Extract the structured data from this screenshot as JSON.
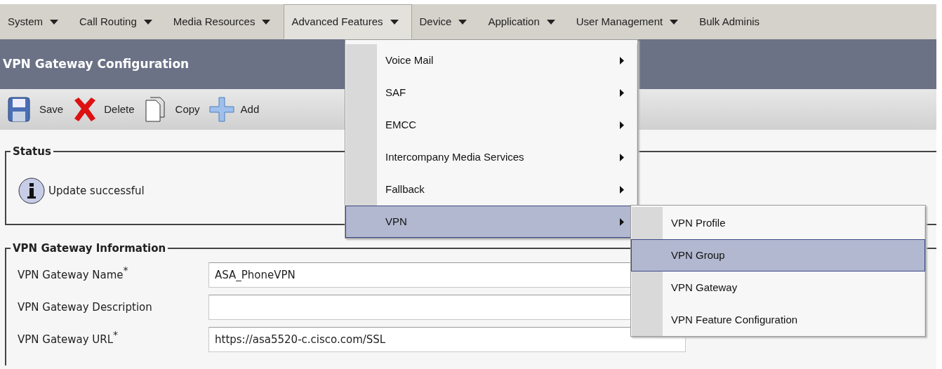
{
  "menu_bar": [
    {
      "label": "System",
      "open": false
    },
    {
      "label": "Call Routing",
      "open": false
    },
    {
      "label": "Media Resources",
      "open": false
    },
    {
      "label": "Advanced Features",
      "open": true
    },
    {
      "label": "Device",
      "open": false
    },
    {
      "label": "Application",
      "open": false
    },
    {
      "label": "User Management",
      "open": false
    },
    {
      "label": "Bulk Adminis",
      "open": false
    }
  ],
  "dropdown": {
    "items": [
      {
        "label": "Voice Mail",
        "selected": false
      },
      {
        "label": "SAF",
        "selected": false
      },
      {
        "label": "EMCC",
        "selected": false
      },
      {
        "label": "Intercompany Media Services",
        "selected": false
      },
      {
        "label": "Fallback",
        "selected": false
      },
      {
        "label": "VPN",
        "selected": true
      }
    ]
  },
  "submenu": {
    "items": [
      {
        "label": "VPN Profile",
        "selected": false
      },
      {
        "label": "VPN Group",
        "selected": true
      },
      {
        "label": "VPN Gateway",
        "selected": false
      },
      {
        "label": "VPN Feature Configuration",
        "selected": false
      }
    ]
  },
  "page_title": "VPN Gateway Configuration",
  "toolbar": [
    {
      "kind": "save",
      "label": "Save"
    },
    {
      "kind": "delete",
      "label": "Delete"
    },
    {
      "kind": "copy",
      "label": "Copy"
    },
    {
      "kind": "add",
      "label": "Add"
    }
  ],
  "status": {
    "legend": "Status",
    "message": "Update successful"
  },
  "info": {
    "legend": "VPN Gateway Information",
    "fields": [
      {
        "label": "VPN Gateway Name$^{*}$",
        "value": "ASA_PhoneVPN"
      },
      {
        "label": "VPN Gateway Description"
      },
      {
        "label": "VPN Gateway URL$^{*}$",
        "value": "https://asa5520-c.cisco.com/SSL"
      }
    ]
  }
}
